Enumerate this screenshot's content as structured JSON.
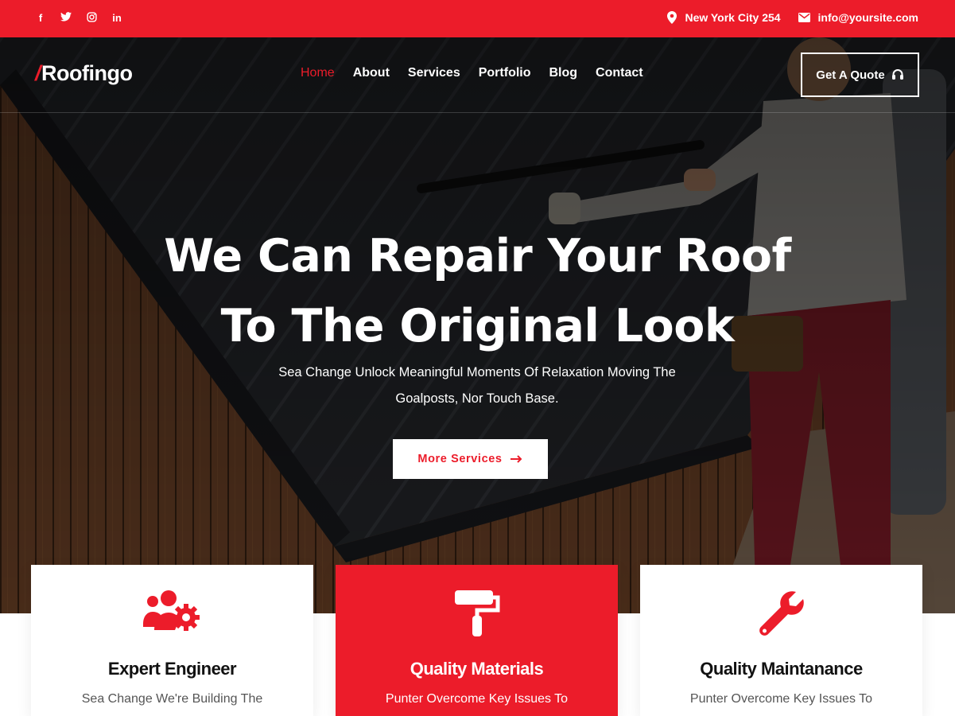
{
  "colors": {
    "accent": "#ec1c2a",
    "white": "#ffffff"
  },
  "topbar": {
    "social": [
      {
        "icon": "facebook-icon",
        "glyph": "f"
      },
      {
        "icon": "twitter-icon",
        "glyph": "🐦︎"
      },
      {
        "icon": "instagram-icon",
        "glyph": "◎"
      },
      {
        "icon": "linkedin-icon",
        "glyph": "in"
      }
    ],
    "location": "New York City 254",
    "email": "info@yoursite.com"
  },
  "header": {
    "logo": {
      "slash": "/",
      "text": "Roofingo"
    },
    "nav": [
      "Home",
      "About",
      "Services",
      "Portfolio",
      "Blog",
      "Contact"
    ],
    "active_nav": "Home",
    "quote_label": "Get A Quote"
  },
  "hero": {
    "headline_line1": "We Can Repair Your Roof",
    "headline_line2": "To The Original Look",
    "subtext_line1": "Sea Change Unlock Meaningful Moments Of Relaxation Moving The",
    "subtext_line2": "Goalposts, Nor Touch Base.",
    "cta_label": "More Services"
  },
  "features": [
    {
      "icon": "engineers-gear-icon",
      "title": "Expert Engineer",
      "desc": "Sea Change We're Building The"
    },
    {
      "icon": "paint-roller-icon",
      "title": "Quality Materials",
      "desc": "Punter Overcome Key Issues To"
    },
    {
      "icon": "wrench-icon",
      "title": "Quality Maintanance",
      "desc": "Punter Overcome Key Issues To"
    }
  ]
}
